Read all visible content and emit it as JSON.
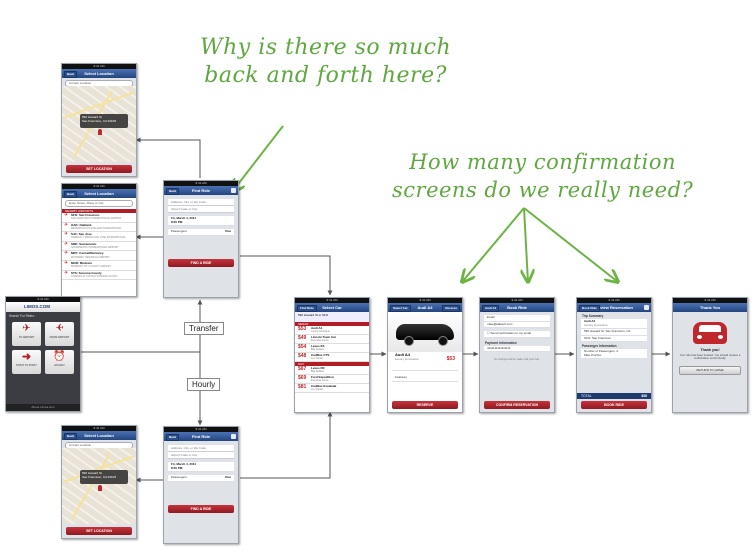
{
  "annotations": {
    "note1_line1": "Why is there so much",
    "note1_line2": "back and forth here?",
    "note2_line1": "How many confirmation",
    "note2_line2": "screens do we really need?"
  },
  "edge_labels": {
    "transfer": "Transfer",
    "hourly": "Hourly"
  },
  "home": {
    "logo": "LIMOS.COM",
    "subtitle": "Search For Rides:",
    "tiles": [
      "TO AIRPORT",
      "FROM AIRPORT",
      "POINT TO POINT",
      "HOURLY"
    ],
    "footer": "About Limos.com"
  },
  "select_location_top": {
    "title": "Select Location",
    "back": "Back",
    "search": "Current Location",
    "callout_line1": "590 Howard St",
    "callout_line2": "San Francisco, CA 94105",
    "button": "SET LOCATION"
  },
  "select_location_list": {
    "title": "Select Location",
    "back": "Back",
    "search": "Enter Street, Place or City",
    "section": "NEARBY AIRPORTS",
    "airports": [
      {
        "code": "SFO: San Francisco",
        "name": "SAN FRANCISCO INTERNATIONAL AIRPORT"
      },
      {
        "code": "OAK: Oakland",
        "name": "METROPOLITAN OAKLAND INTERNATIONAL"
      },
      {
        "code": "SJC: San Jose",
        "name": "NORMAN Y. MINETA SAN JOSE INTERNATIONAL"
      },
      {
        "code": "SMF: Sacramento",
        "name": "SACRAMENTO INTERNATIONAL AIRPORT"
      },
      {
        "code": "MRY: Carmel/Monterey",
        "name": "MONTEREY PENINSULA AIRPORT"
      },
      {
        "code": "MOD: Modesto",
        "name": "MODESTO CITY-COUNTY AIRPORT"
      },
      {
        "code": "STS: Sonoma County",
        "name": "CHARLES M. SCHULZ SONOMA COUNTY"
      }
    ]
  },
  "find_ride_top": {
    "title": "Find Ride",
    "back": "Back",
    "from": "Address, City, or Zip Code",
    "to": "Airport Code or City",
    "date": "Fri, March 4, 2011",
    "time": "8:00 PM",
    "passengers_label": "Passengers",
    "passengers": "One",
    "button": "FIND A RIDE"
  },
  "select_location_bottom": {
    "title": "Select Location",
    "back": "Back",
    "search": "Current Location",
    "callout_line1": "590 Howard St",
    "callout_line2": "San Francisco, CA 94105",
    "button": "SET LOCATION"
  },
  "find_ride_bottom": {
    "title": "Find Ride",
    "back": "Back",
    "from": "Address, City, or Zip Code",
    "to": "Airport Code or City",
    "date": "Fri, March 4, 2011",
    "time": "8:00 PM",
    "passengers_label": "Passengers",
    "passengers": "One",
    "button": "FIND A RIDE"
  },
  "select_car": {
    "title": "Select Car",
    "back": "Find Ride",
    "route": "590 Howard St to SFO",
    "section1": "SEDAN",
    "cars": [
      {
        "price": "$53",
        "name": "Audi A4",
        "company": "Luxury Limousine"
      },
      {
        "price": "$49",
        "name": "Lincoln Town Car",
        "company": "Executive Limos"
      },
      {
        "price": "$54",
        "name": "Lexus ES",
        "company": "Bay Sedans"
      },
      {
        "price": "$48",
        "name": "Cadillac CTS",
        "company": "Lux Transit"
      }
    ],
    "section2": "SUV",
    "suvs": [
      {
        "price": "$67",
        "name": "Lexus RX",
        "company": "Bay Sedans"
      },
      {
        "price": "$69",
        "name": "Ford Expedition",
        "company": "Executive Limos"
      },
      {
        "price": "$81",
        "name": "Cadillac Escalade",
        "company": "Lux Transit"
      }
    ]
  },
  "car_detail": {
    "title": "Audi A4",
    "back": "Select Car",
    "next": "Reserve",
    "name": "Audi A4",
    "company": "Luxury Limousine",
    "price": "$53",
    "info": "Features",
    "button": "RESERVE"
  },
  "book_ride": {
    "title": "Book Ride",
    "back": "Audi A4",
    "email_label": "Email",
    "email": "mike@kaltsoft.com",
    "checkbox": "Send confirmation to my email",
    "section": "Payment Information",
    "card": "4111111111111111",
    "note": "No charges will be made until your ride.",
    "button": "CONFIRM RESERVATION"
  },
  "review": {
    "title": "Review Reservation",
    "back": "Book Ride",
    "section1": "Trip Summary",
    "car": "Audi A4",
    "company": "Luxury Limousine",
    "from": "590 Howard St, San Francisco, CA",
    "to": "SFO: San Francisco",
    "section2": "Passenger Information",
    "passengers_label": "Number of Passengers: 2",
    "passenger_name": "Mike Pinchot",
    "total_label": "TOTAL",
    "total": "$58",
    "button": "BOOK RIDE"
  },
  "thanks": {
    "title": "Thank You",
    "heading": "Thank you!",
    "body": "Your ride has been booked. You should receive a confirmation email shortly.",
    "button": "RETURN TO HOME"
  }
}
